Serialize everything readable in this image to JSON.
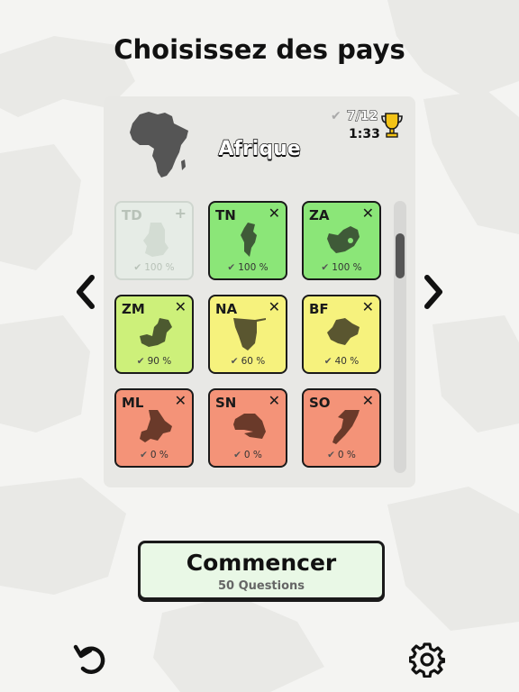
{
  "header": {
    "title": "Choisissez des pays"
  },
  "panel": {
    "continent": "Afrique",
    "stats": {
      "check_icon": "✔",
      "count": "7/12",
      "time": "1:33"
    }
  },
  "colors": {
    "green": "#8be678",
    "lime": "#cdf07a",
    "yellow": "#f6f27d",
    "red": "#f49378"
  },
  "tiles": [
    {
      "code": "TD",
      "action": "+",
      "percent": "100 %",
      "tick": "✔"
    },
    {
      "code": "TN",
      "action": "✕",
      "percent": "100 %",
      "tick": "✔"
    },
    {
      "code": "ZA",
      "action": "✕",
      "percent": "100 %",
      "tick": "✔"
    },
    {
      "code": "ZM",
      "action": "✕",
      "percent": "90 %",
      "tick": "✔"
    },
    {
      "code": "NA",
      "action": "✕",
      "percent": "60 %",
      "tick": "✔"
    },
    {
      "code": "BF",
      "action": "✕",
      "percent": "40 %",
      "tick": "✔"
    },
    {
      "code": "ML",
      "action": "✕",
      "percent": "0 %",
      "tick": "✔"
    },
    {
      "code": "SN",
      "action": "✕",
      "percent": "0 %",
      "tick": "✔"
    },
    {
      "code": "SO",
      "action": "✕",
      "percent": "0 %",
      "tick": "✔"
    }
  ],
  "start": {
    "label": "Commencer",
    "sub": "50 Questions"
  },
  "icons": {
    "prev": "chevron-left-icon",
    "next": "chevron-right-icon",
    "undo": "undo-icon",
    "settings": "gear-icon",
    "trophy": "trophy-icon"
  }
}
